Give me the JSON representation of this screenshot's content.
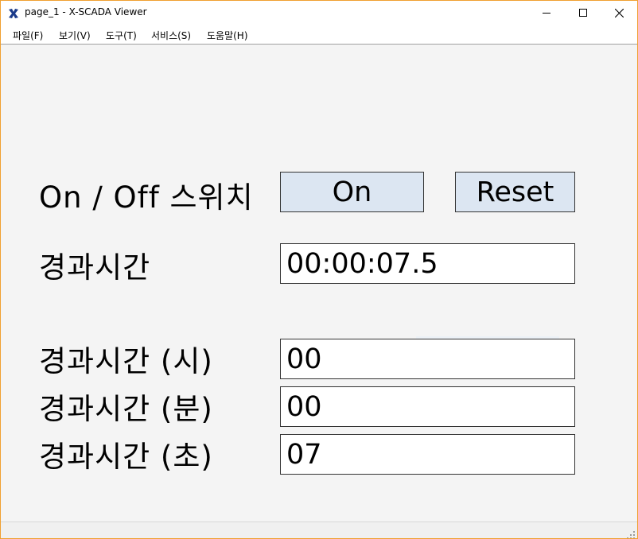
{
  "window": {
    "title": "page_1 - X-SCADA Viewer",
    "app_icon": "x-scada-logo-icon",
    "controls": {
      "minimize_icon": "minimize-icon",
      "maximize_icon": "maximize-icon",
      "close_icon": "close-icon"
    }
  },
  "menu": {
    "items": [
      {
        "label": "파일(F)"
      },
      {
        "label": "보기(V)"
      },
      {
        "label": "도구(T)"
      },
      {
        "label": "서비스(S)"
      },
      {
        "label": "도움말(H)"
      }
    ]
  },
  "panel": {
    "switch_label": "On / Off 스위치",
    "on_button": "On",
    "reset_button": "Reset",
    "elapsed_label": "경과시간",
    "elapsed_value": "00:00:07.5",
    "hours_label": "경과시간 (시)",
    "hours_value": "00",
    "minutes_label": "경과시간 (분)",
    "minutes_value": "00",
    "seconds_label": "경과시간 (초)",
    "seconds_value": "07"
  },
  "colors": {
    "button_bg": "#dce6f2",
    "window_border": "#f0a030",
    "logo": "#1a3a8a"
  }
}
